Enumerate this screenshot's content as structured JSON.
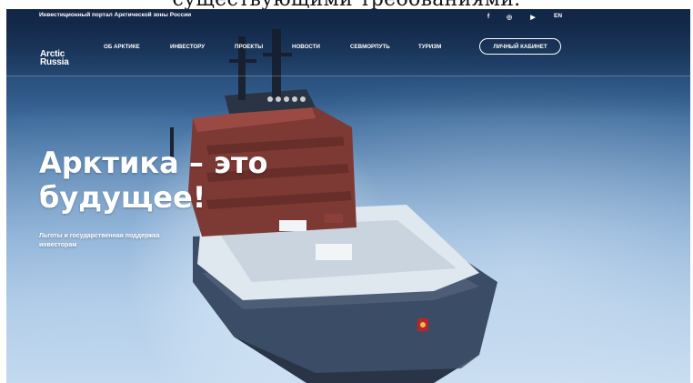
{
  "caption": {
    "text": "существующими требованиями."
  },
  "topbar": {
    "portal_title": "Инвестиционный портал Арктической зоны России",
    "social": [
      {
        "name": "facebook-icon",
        "glyph": "f"
      },
      {
        "name": "instagram-icon",
        "glyph": "◎"
      },
      {
        "name": "youtube-icon",
        "glyph": "▶"
      }
    ],
    "language": "EN"
  },
  "header": {
    "logo_line1": "Arctic",
    "logo_line2": "Russia",
    "menu": [
      {
        "label": "ОБ АРКТИКЕ"
      },
      {
        "label": "ИНВЕСТОРУ"
      },
      {
        "label": "ПРОЕКТЫ"
      },
      {
        "label": "НОВОСТИ"
      },
      {
        "label": "СЕВМОРПУТЬ"
      },
      {
        "label": "ТУРИЗМ"
      }
    ],
    "cabinet_button": "ЛИЧНЫЙ КАБИНЕТ"
  },
  "hero": {
    "title_line1": "Арктика – это",
    "title_line2": "будущее!",
    "subtitle_line1": "Льготы и государственная поддержка",
    "subtitle_line2": "инвесторам",
    "slides_count": 5
  },
  "colors": {
    "header_overlay": "#0c1c37",
    "text": "#ffffff",
    "ice": "#a9c6e3",
    "hull": "#3a4c66",
    "superstructure": "#7d3a35"
  }
}
